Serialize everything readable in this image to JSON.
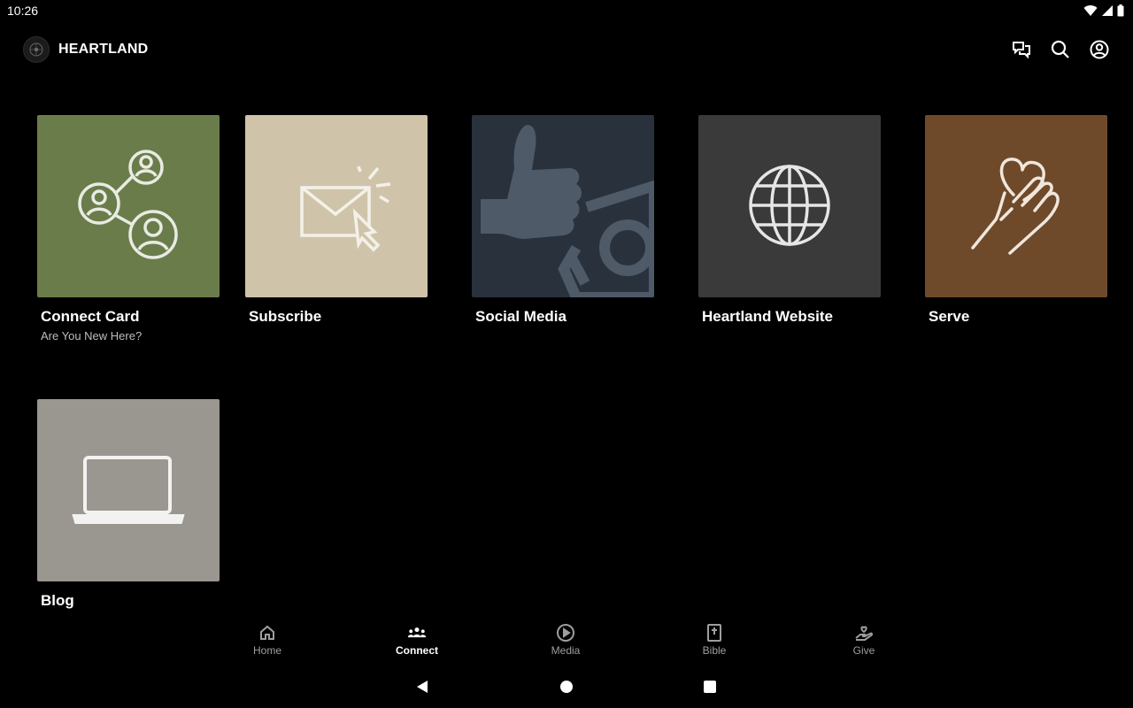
{
  "status_bar": {
    "time": "10:26",
    "icons": [
      "wifi-icon",
      "signal-icon",
      "battery-icon"
    ]
  },
  "app_bar": {
    "title": "HEARTLAND",
    "actions": [
      "chat-icon",
      "search-icon",
      "account-icon"
    ]
  },
  "tiles": [
    {
      "title": "Connect Card",
      "subtitle": "Are You New Here?",
      "color": "#6b7c4b",
      "icon": "share-people-icon"
    },
    {
      "title": "Subscribe",
      "subtitle": "",
      "color": "#cfc4a9",
      "icon": "email-click-icon"
    },
    {
      "title": "Social Media",
      "subtitle": "",
      "color": "#28313c",
      "icon": "thumbs-up-camera-icon"
    },
    {
      "title": "Heartland Website",
      "subtitle": "",
      "color": "#3a3a3a",
      "icon": "globe-icon"
    },
    {
      "title": "Serve",
      "subtitle": "",
      "color": "#6e4a2b",
      "icon": "hand-heart-icon"
    },
    {
      "title": "Blog",
      "subtitle": "",
      "color": "#9a9690",
      "icon": "laptop-icon"
    }
  ],
  "bottom_nav": {
    "active": "Connect",
    "items": [
      {
        "label": "Home",
        "icon": "home-icon"
      },
      {
        "label": "Connect",
        "icon": "people-icon"
      },
      {
        "label": "Media",
        "icon": "play-circle-icon"
      },
      {
        "label": "Bible",
        "icon": "bible-icon"
      },
      {
        "label": "Give",
        "icon": "give-heart-icon"
      }
    ]
  },
  "system_nav": [
    "back-icon",
    "home-circle-icon",
    "recents-icon"
  ]
}
